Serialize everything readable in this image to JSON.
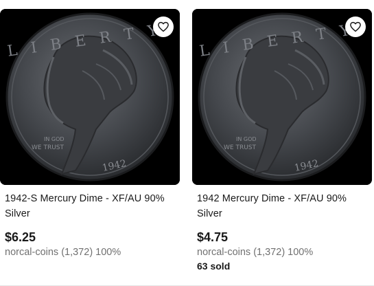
{
  "listings": [
    {
      "title": "1942-S Mercury Dime - XF/AU 90% Silver",
      "price": "$6.25",
      "seller": "norcal-coins (1,372) 100%",
      "sold": "",
      "watch_icon": "heart-icon",
      "coin_inscription": {
        "legend": "LIBERTY",
        "motto_1": "IN GOD",
        "motto_2": "WE TRUST",
        "year": "1942"
      }
    },
    {
      "title": "1942 Mercury Dime - XF/AU 90% Silver",
      "price": "$4.75",
      "seller": "norcal-coins (1,372) 100%",
      "sold": "63 sold",
      "watch_icon": "heart-icon",
      "coin_inscription": {
        "legend": "LIBERTY",
        "motto_1": "IN GOD",
        "motto_2": "WE TRUST",
        "year": "1942"
      }
    }
  ],
  "colors": {
    "price": "#191919",
    "seller": "#707070",
    "image_bg": "#000000"
  }
}
